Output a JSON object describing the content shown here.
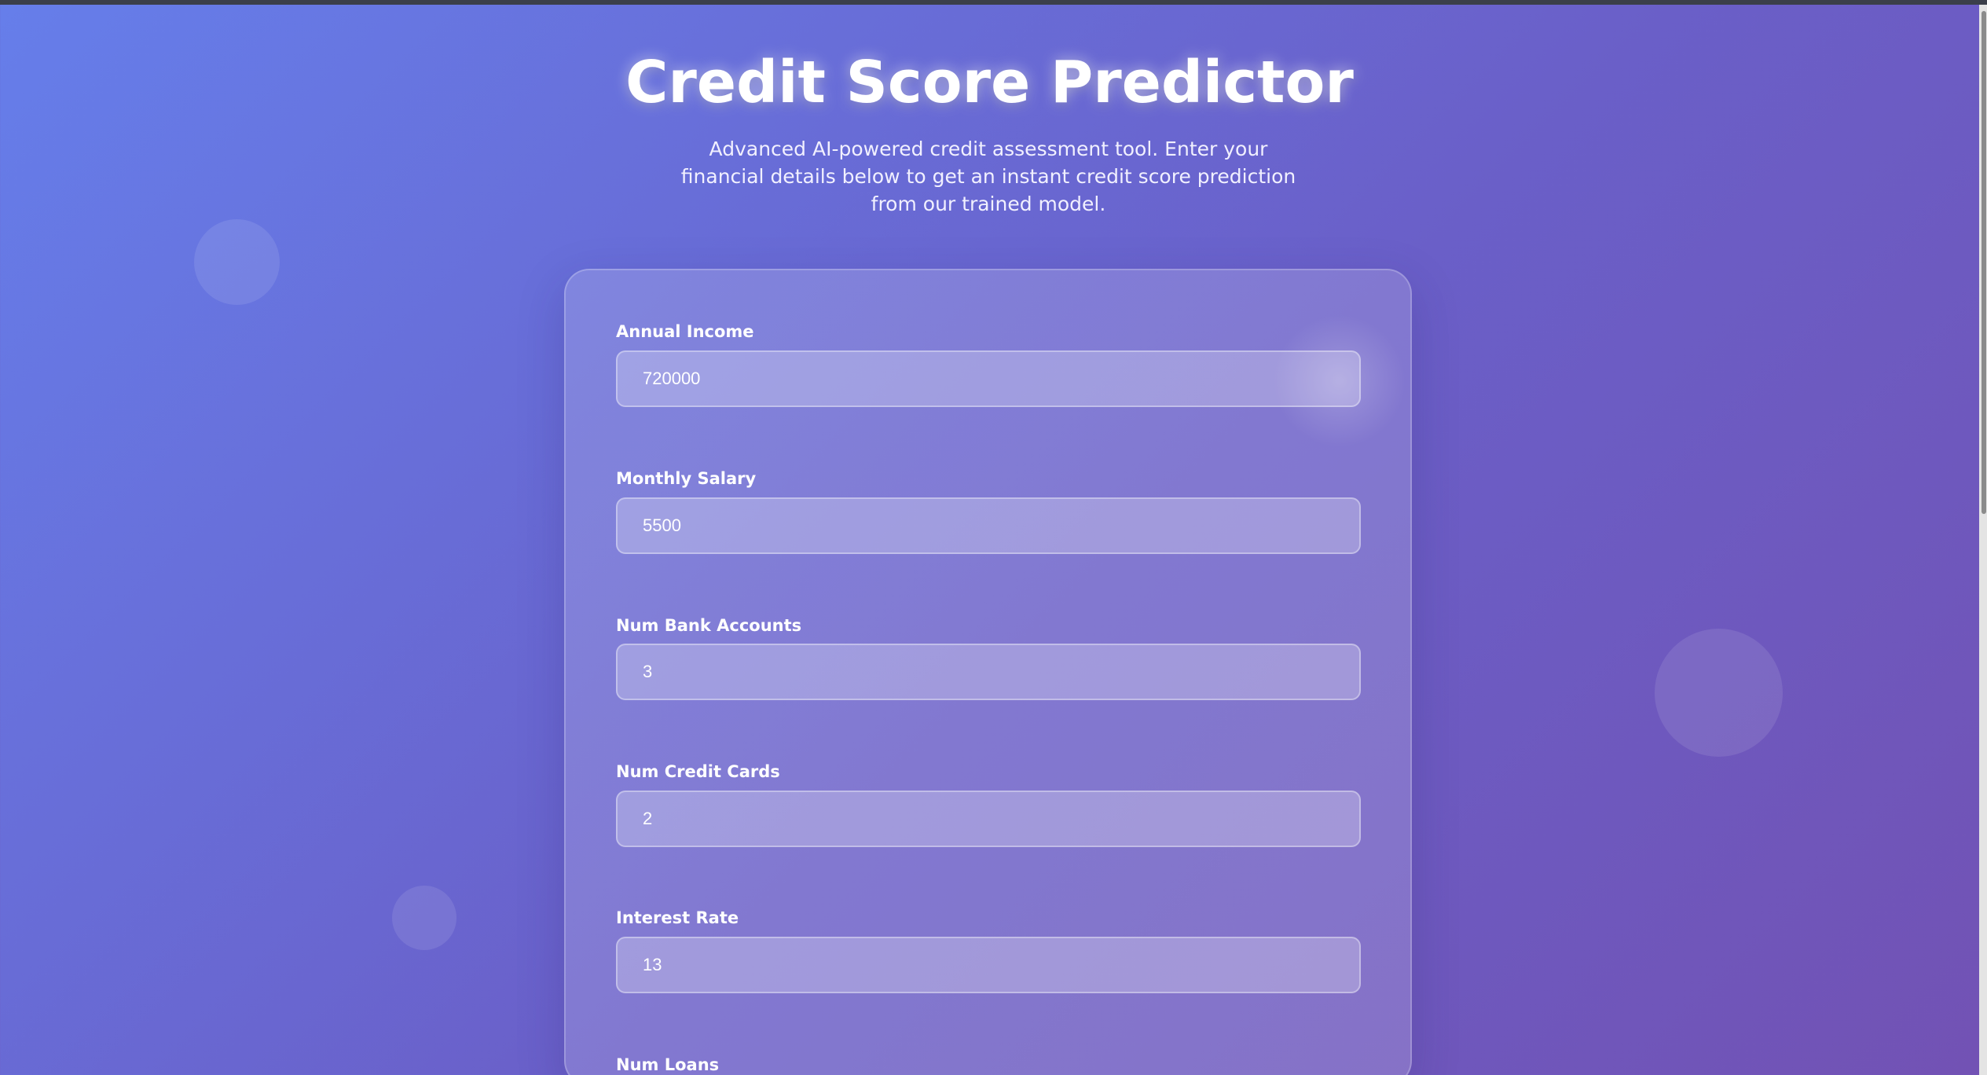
{
  "page": {
    "title": "Credit Score Predictor",
    "subtitle": "Advanced AI-powered credit assessment tool. Enter your financial details below to get an instant credit score prediction from our trained model."
  },
  "form": {
    "fields": [
      {
        "label": "Annual Income",
        "value": "720000"
      },
      {
        "label": "Monthly Salary",
        "value": "5500"
      },
      {
        "label": "Num Bank Accounts",
        "value": "3"
      },
      {
        "label": "Num Credit Cards",
        "value": "2"
      },
      {
        "label": "Interest Rate",
        "value": "13"
      },
      {
        "label": "Num Loans",
        "value": ""
      }
    ]
  },
  "colors": {
    "gradient_start": "#667eea",
    "gradient_end": "#7252b4",
    "text": "#ffffff"
  }
}
